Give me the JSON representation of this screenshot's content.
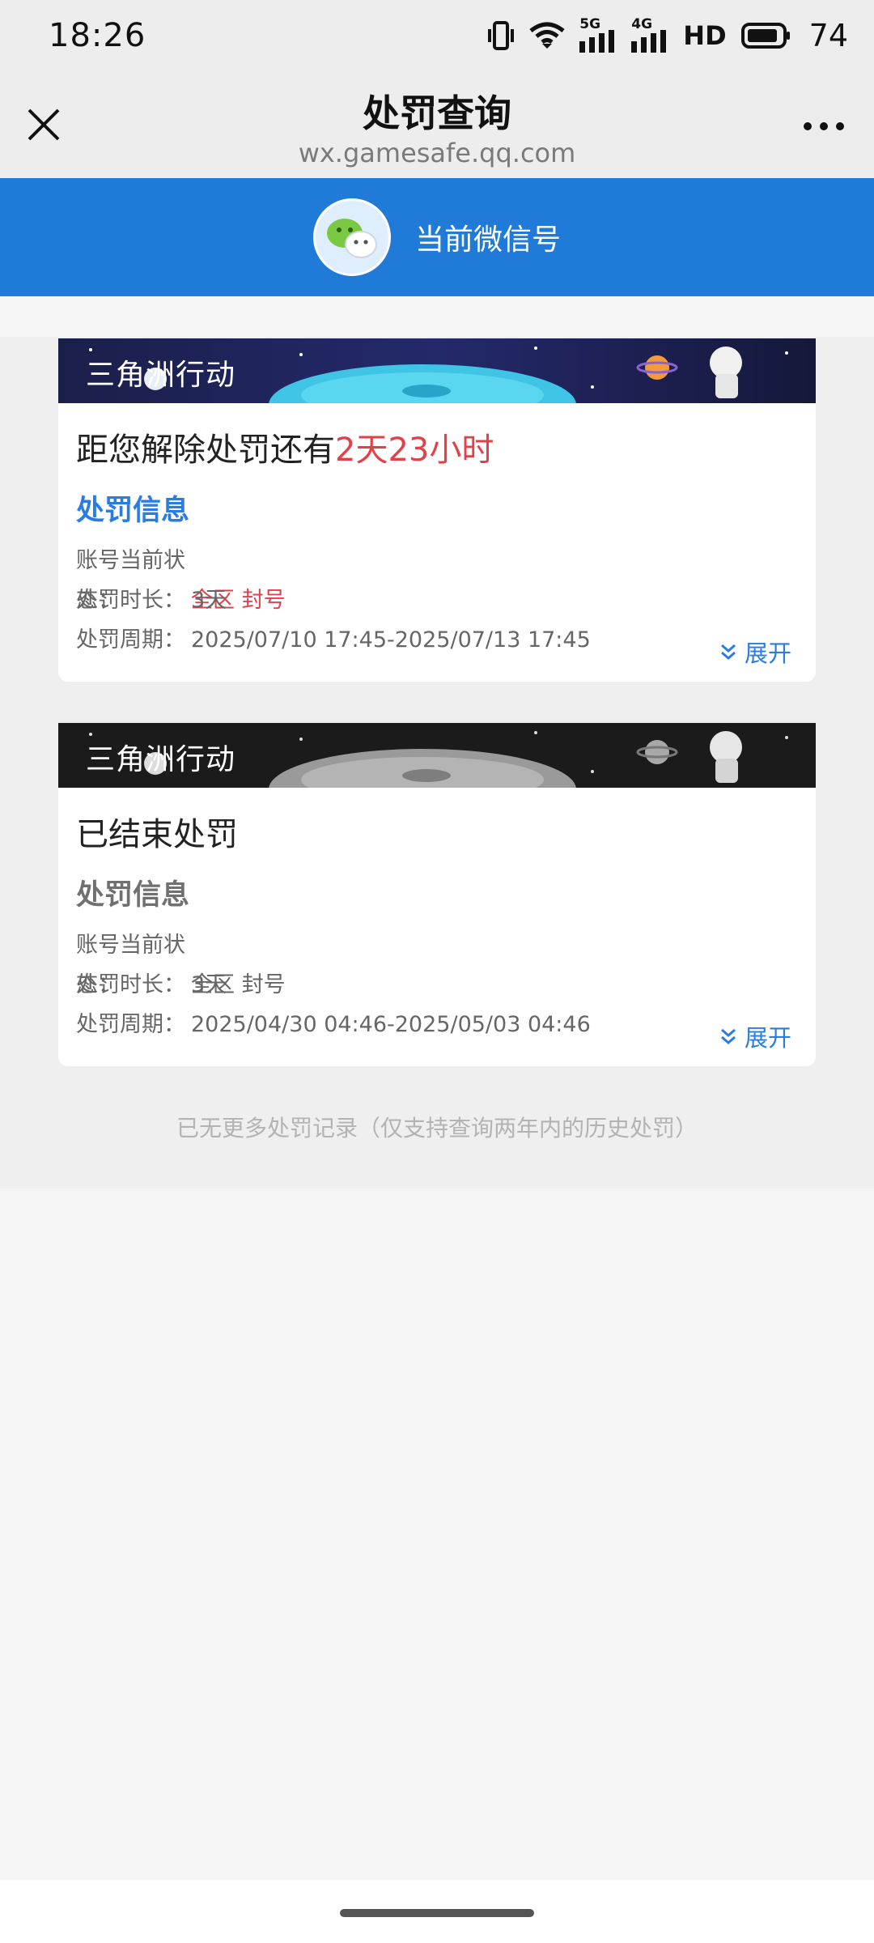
{
  "status_bar": {
    "time": "18:26",
    "network_1": "5G",
    "network_2": "4G",
    "hd": "HD",
    "battery": "74",
    "icons": [
      "vibrate-icon",
      "wifi-icon",
      "signal-icon",
      "signal-icon",
      "battery-icon"
    ]
  },
  "nav": {
    "title": "处罚查询",
    "url": "wx.gamesafe.qq.com",
    "close_icon": "close-icon",
    "more_icon": "more-icon"
  },
  "header": {
    "account_label": "当前微信号",
    "avatar_icon": "wechat-icon",
    "bg_color": "#1f7ad8"
  },
  "records": [
    {
      "game": "三角洲行动",
      "countdown_prefix": "距您解除处罚还有",
      "countdown_value": "2天23小时",
      "section_title": "处罚信息",
      "status_label": "账号当前状态：",
      "status_value": "全区 封号",
      "duration_label": "处罚时长：",
      "duration_value": "3天",
      "period_label": "处罚周期：",
      "period_value": "2025/07/10 17:45-2025/07/13 17:45",
      "expand_label": "展开"
    },
    {
      "game": "三角洲行动",
      "status_text": "已结束处罚",
      "section_title": "处罚信息",
      "status_label": "账号当前状态：",
      "status_value": "全区 封号",
      "duration_label": "处罚时长：",
      "duration_value": "3天",
      "period_label": "处罚周期：",
      "period_value": "2025/04/30 04:46-2025/05/03 04:46",
      "expand_label": "展开"
    }
  ],
  "footer_note": "已无更多处罚记录（仅支持查询两年内的历史处罚）",
  "colors": {
    "accent_blue": "#2a7de0",
    "alert_red": "#e0414a"
  }
}
